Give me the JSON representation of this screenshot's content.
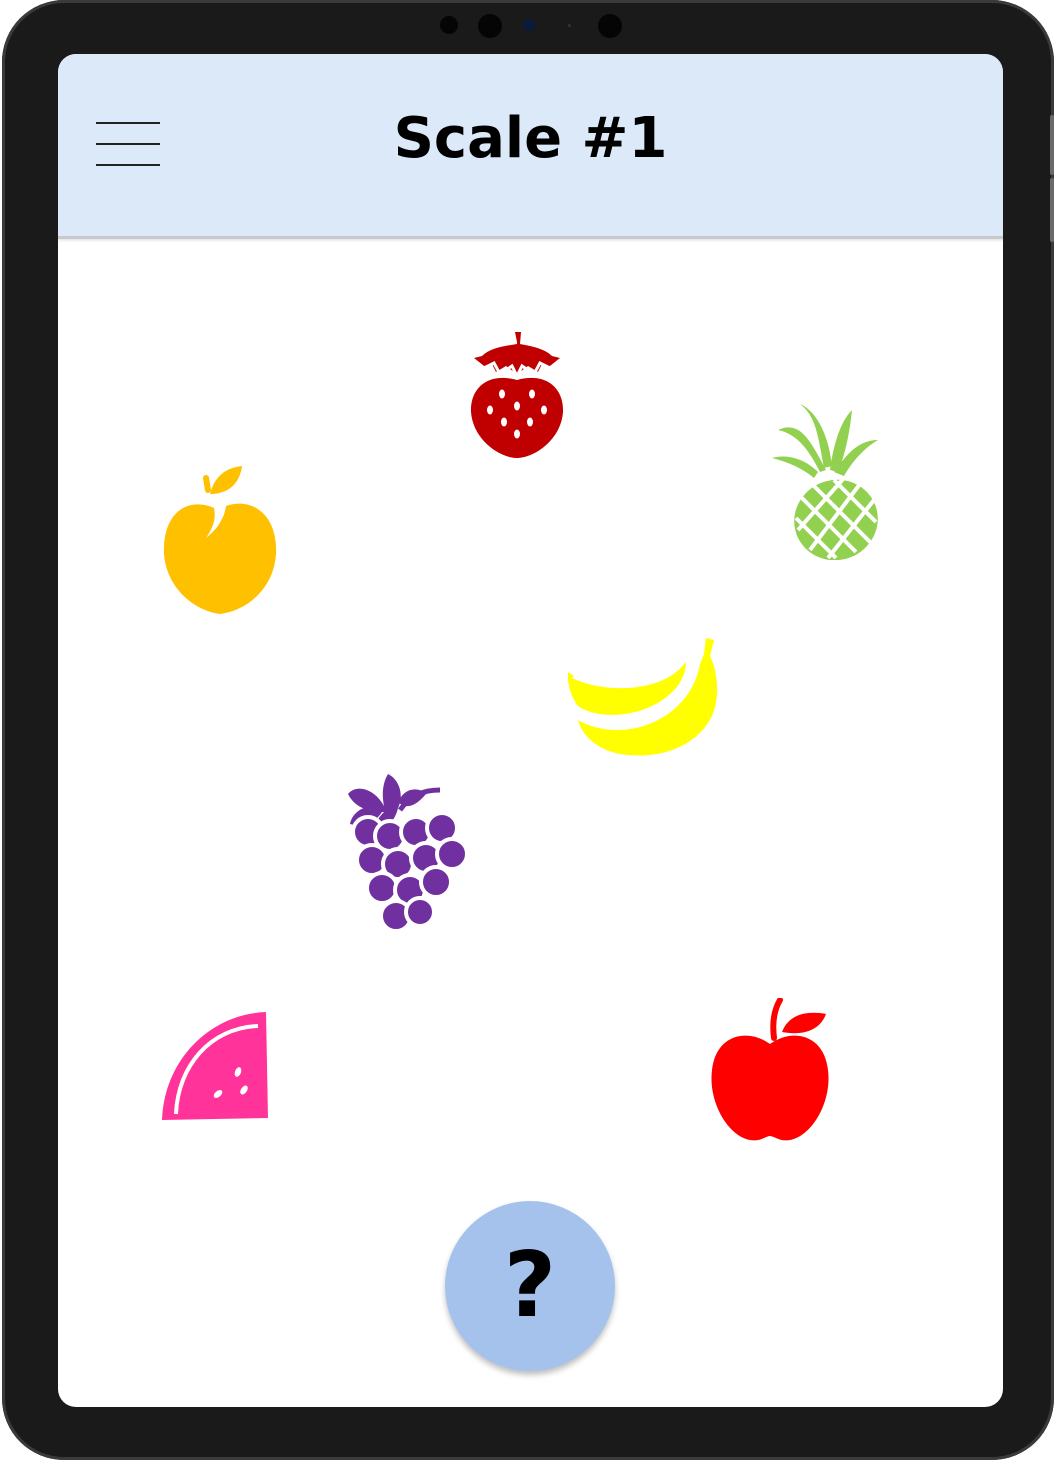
{
  "header": {
    "title": "Scale #1",
    "menu_icon": "hamburger-menu-icon"
  },
  "help": {
    "label": "?"
  },
  "fruits": [
    {
      "name": "strawberry",
      "color": "#c00000"
    },
    {
      "name": "pineapple",
      "color": "#92d050"
    },
    {
      "name": "peach",
      "color": "#ffc000"
    },
    {
      "name": "banana",
      "color": "#ffff00"
    },
    {
      "name": "grapes",
      "color": "#7030a0"
    },
    {
      "name": "watermelon",
      "color": "#ff3399"
    },
    {
      "name": "apple",
      "color": "#ff0000"
    }
  ],
  "colors": {
    "header_bg": "#dbe9f8",
    "help_button_bg": "#a4c2ec",
    "device_frame": "#1a1a1a"
  }
}
